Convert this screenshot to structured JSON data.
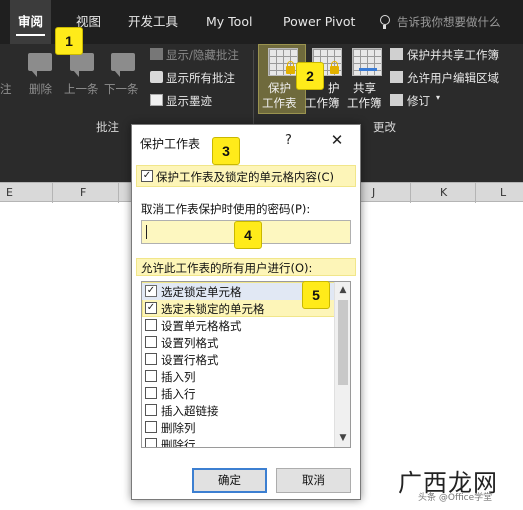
{
  "ribbon": {
    "tabs": [
      "审阅",
      "视图",
      "开发工具",
      "My Tool",
      "Power Pivot"
    ],
    "active_tab": "审阅",
    "tell_me": "告诉我你想要做什么",
    "comments_group": {
      "label": "批注",
      "partial_label": "注",
      "delete": "删除",
      "previous": "上一条",
      "next": "下一条",
      "show_hide": "显示/隐藏批注",
      "show_all": "显示所有批注",
      "show_ink": "显示墨迹"
    },
    "changes_group": {
      "label": "更改",
      "protect_sheet_line1": "保护",
      "protect_sheet_line2": "工作表",
      "protect_workbook_line1": "护",
      "protect_workbook_line2": "工作簿",
      "share_workbook_line1": "共享",
      "share_workbook_line2": "工作簿",
      "protect_and_share": "保护并共享工作簿",
      "allow_edit_ranges": "允许用户编辑区域",
      "track_changes": "修订"
    },
    "columns": [
      "E",
      "F",
      "J",
      "K",
      "L"
    ]
  },
  "dialog": {
    "title": "保护工作表",
    "help": "?",
    "close": "✕",
    "protect_checkbox": {
      "label": "保护工作表及锁定的单元格内容(C)",
      "checked": true
    },
    "password_label": "取消工作表保护时使用的密码(P):",
    "password_value": "",
    "allow_label": "允许此工作表的所有用户进行(O):",
    "options": [
      {
        "label": "选定锁定单元格",
        "checked": true
      },
      {
        "label": "选定未锁定的单元格",
        "checked": true
      },
      {
        "label": "设置单元格格式",
        "checked": false
      },
      {
        "label": "设置列格式",
        "checked": false
      },
      {
        "label": "设置行格式",
        "checked": false
      },
      {
        "label": "插入列",
        "checked": false
      },
      {
        "label": "插入行",
        "checked": false
      },
      {
        "label": "插入超链接",
        "checked": false
      },
      {
        "label": "删除列",
        "checked": false
      },
      {
        "label": "删除行",
        "checked": false
      }
    ],
    "ok": "确定",
    "cancel": "取消"
  },
  "badges": [
    "1",
    "2",
    "3",
    "4",
    "5"
  ],
  "watermark": {
    "logo": "广西龙网",
    "sub": "头条 @Office学堂"
  },
  "colors": {
    "badge": "#ffeb1a",
    "highlight": "#fdf5b8",
    "ribbon_bg": "#2b2b2b",
    "ok_border": "#3c7fd1"
  }
}
